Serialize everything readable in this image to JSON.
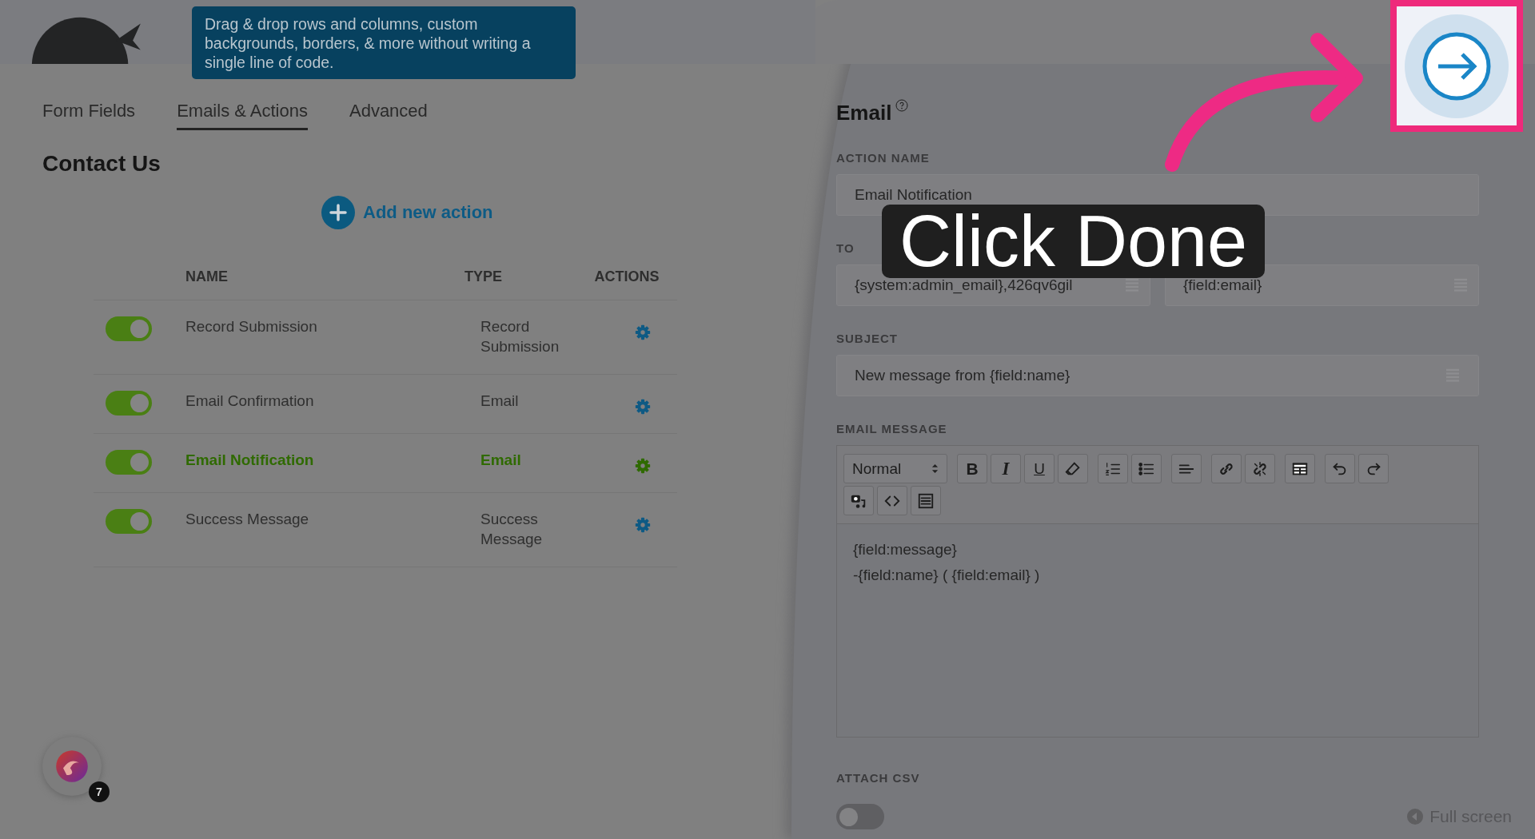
{
  "tooltip": {
    "text": "Drag & drop rows and columns, custom backgrounds, borders, & more without writing a single line of code."
  },
  "tabs": [
    {
      "label": "Form Fields",
      "selected": false
    },
    {
      "label": "Emails & Actions",
      "selected": true
    },
    {
      "label": "Advanced",
      "selected": false
    }
  ],
  "form_title": "Contact Us",
  "add_action": {
    "label": "Add new action"
  },
  "table": {
    "columns": [
      "NAME",
      "TYPE",
      "ACTIONS"
    ],
    "rows": [
      {
        "on": true,
        "name": "Record Submission",
        "type": "Record Submission",
        "selected": false
      },
      {
        "on": true,
        "name": "Email Confirmation",
        "type": "Email",
        "selected": false
      },
      {
        "on": true,
        "name": "Email Notification",
        "type": "Email",
        "selected": true
      },
      {
        "on": true,
        "name": "Success Message",
        "type": "Success Message",
        "selected": false
      }
    ]
  },
  "launcher": {
    "badge": "7"
  },
  "email_panel": {
    "title": "Email",
    "action_name": {
      "label": "ACTION NAME",
      "value": "Email Notification"
    },
    "to": {
      "label": "TO",
      "value": "{system:admin_email},426qv6gil"
    },
    "reply_to": {
      "value": "{field:email}"
    },
    "subject": {
      "label": "SUBJECT",
      "value": "New message from {field:name}"
    },
    "message": {
      "label": "EMAIL MESSAGE",
      "format": "Normal",
      "toolbar": [
        [
          {
            "kind": "bold",
            "label": "B"
          },
          {
            "kind": "italic",
            "label": "I"
          },
          {
            "kind": "underline",
            "label": "U"
          },
          {
            "kind": "eraser"
          }
        ],
        [
          {
            "kind": "ordered-list"
          },
          {
            "kind": "bullet-list"
          }
        ],
        [
          {
            "kind": "align"
          }
        ],
        [
          {
            "kind": "link"
          },
          {
            "kind": "unlink"
          }
        ],
        [
          {
            "kind": "table"
          }
        ],
        [
          {
            "kind": "undo"
          },
          {
            "kind": "redo"
          }
        ],
        [
          {
            "kind": "media"
          },
          {
            "kind": "code"
          },
          {
            "kind": "source"
          }
        ]
      ],
      "lines": [
        "{field:message}",
        "-{field:name} ( {field:email} )"
      ]
    },
    "attach_csv": {
      "label": "ATTACH CSV",
      "on": false
    },
    "full_screen": "Full screen"
  },
  "overlay": {
    "caption": "Click Done"
  }
}
